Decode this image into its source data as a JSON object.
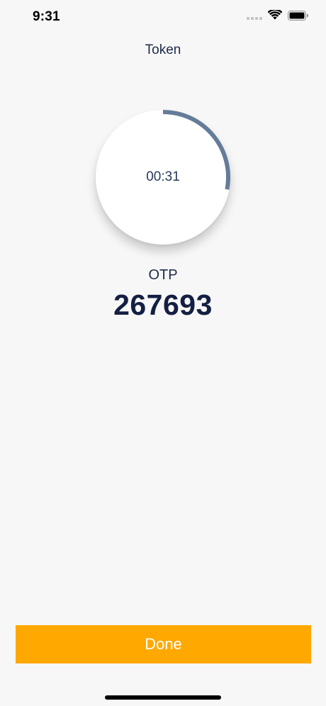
{
  "status_bar": {
    "time": "9:31",
    "icons": [
      "signal-icon",
      "wifi-icon",
      "battery-icon"
    ]
  },
  "header": {
    "title": "Token"
  },
  "countdown": {
    "time_remaining": "00:31",
    "progress_fraction": 0.28,
    "ring_color": "#647c99"
  },
  "otp": {
    "label": "OTP",
    "code": "267693"
  },
  "actions": {
    "done_label": "Done",
    "done_color": "#ffa800"
  }
}
